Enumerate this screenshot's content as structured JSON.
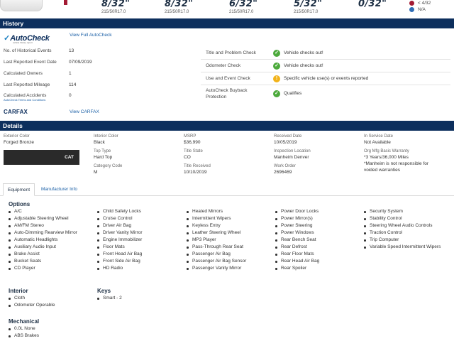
{
  "tires": [
    {
      "depth": "8/32\"",
      "size": "215/50R17.0"
    },
    {
      "depth": "8/32\"",
      "size": "215/50R17.0"
    },
    {
      "depth": "6/32\"",
      "size": "215/50R17.0"
    },
    {
      "depth": "5/32\"",
      "size": "215/50R17.0"
    },
    {
      "depth": "0/32\"",
      "size": ""
    }
  ],
  "tire_legend": [
    {
      "label": "< 4/32",
      "color": "#a31b34"
    },
    {
      "label": "N/A",
      "color": "#2f6db5"
    }
  ],
  "history": {
    "title": "History",
    "autocheck_logo": "AutoCheck",
    "autocheck_tagline": "vehicle history report",
    "view_autocheck": "View Full AutoCheck",
    "rows": [
      {
        "label": "No. of Historical Events",
        "value": "13"
      },
      {
        "label": "Last Reported Event Date",
        "value": "07/09/2019"
      },
      {
        "label": "Calculated Owners",
        "value": "1"
      },
      {
        "label": "Last Reported Mileage",
        "value": "114"
      },
      {
        "label": "Calculated Accidents",
        "value": "0"
      }
    ],
    "terms_link": "AutoCheck Terms and Conditions",
    "checks": [
      {
        "label": "Title and Problem Check",
        "status": "green",
        "text": "Vehicle checks out!"
      },
      {
        "label": "Odometer Check",
        "status": "green",
        "text": "Vehicle checks out!"
      },
      {
        "label": "Use and Event Check",
        "status": "yellow",
        "text": "Specific vehicle use(s) or events reported"
      },
      {
        "label": "AutoCheck Buyback Protection",
        "status": "green",
        "text": "Qualifies"
      }
    ],
    "carfax_logo": "CARFAX",
    "view_carfax": "View CARFAX"
  },
  "details": {
    "title": "Details",
    "exterior_color_label": "Exterior Color",
    "exterior_color": "Forged Bronze",
    "swatch_text": "CAT",
    "interior_color_label": "Interior Color",
    "interior_color": "Black",
    "top_type_label": "Top Type",
    "top_type": "Hard Top",
    "category_code_label": "Category Code",
    "category_code": "M",
    "msrp_label": "MSRP",
    "msrp": "$36,990",
    "title_state_label": "Title State",
    "title_state": "CO",
    "title_received_label": "Title Received",
    "title_received": "10/10/2019",
    "received_date_label": "Received Date",
    "received_date": "10/05/2019",
    "inspection_location_label": "Inspection Location",
    "inspection_location": "Manheim Denver",
    "work_order_label": "Work Order",
    "work_order": "2696469",
    "in_service_label": "In Service Date",
    "in_service": "Not Available",
    "warranty_label": "Org Mfg Basic Warranty",
    "warranty_1": "*3 Years/36,000 Miles",
    "warranty_2": "*Manheim is not responsible for",
    "warranty_3": "voided warranties"
  },
  "tabs": [
    "Equipment",
    "Manufacturer Info"
  ],
  "options": {
    "title": "Options",
    "columns": [
      [
        "A/C",
        "Adjustable Steering Wheel",
        "AM/FM Stereo",
        "Auto-Dimming Rearview Mirror",
        "Automatic Headlights",
        "Auxiliary Audio Input",
        "Brake Assist",
        "Bucket Seats",
        "CD Player"
      ],
      [
        "Child Safety Locks",
        "Cruise Control",
        "Driver Air Bag",
        "Driver Vanity Mirror",
        "Engine Immobilizer",
        "Floor Mats",
        "Front Head Air Bag",
        "Front Side Air Bag",
        "HD Radio"
      ],
      [
        "Heated Mirrors",
        "Intermittent Wipers",
        "Keyless Entry",
        "Leather Steering Wheel",
        "MP3 Player",
        "Pass-Through Rear Seat",
        "Passenger Air Bag",
        "Passenger Air Bag Sensor",
        "Passenger Vanity Mirror"
      ],
      [
        "Power Door Locks",
        "Power Mirror(s)",
        "Power Steering",
        "Power Windows",
        "Rear Bench Seat",
        "Rear Defrost",
        "Rear Floor Mats",
        "Rear Head Air Bag",
        "Rear Spoiler"
      ],
      [
        "Security System",
        "Stability Control",
        "Steering Wheel Audio Controls",
        "Traction Control",
        "Trip Computer",
        "Variable Speed Intermittent Wipers"
      ]
    ]
  },
  "interior": {
    "title": "Interior",
    "items": [
      "Cloth",
      "Odometer Operable"
    ]
  },
  "keys": {
    "title": "Keys",
    "items": [
      "Smart - 2"
    ]
  },
  "mechanical": {
    "title": "Mechanical",
    "items": [
      "0.0L None",
      "ABS Brakes"
    ]
  }
}
